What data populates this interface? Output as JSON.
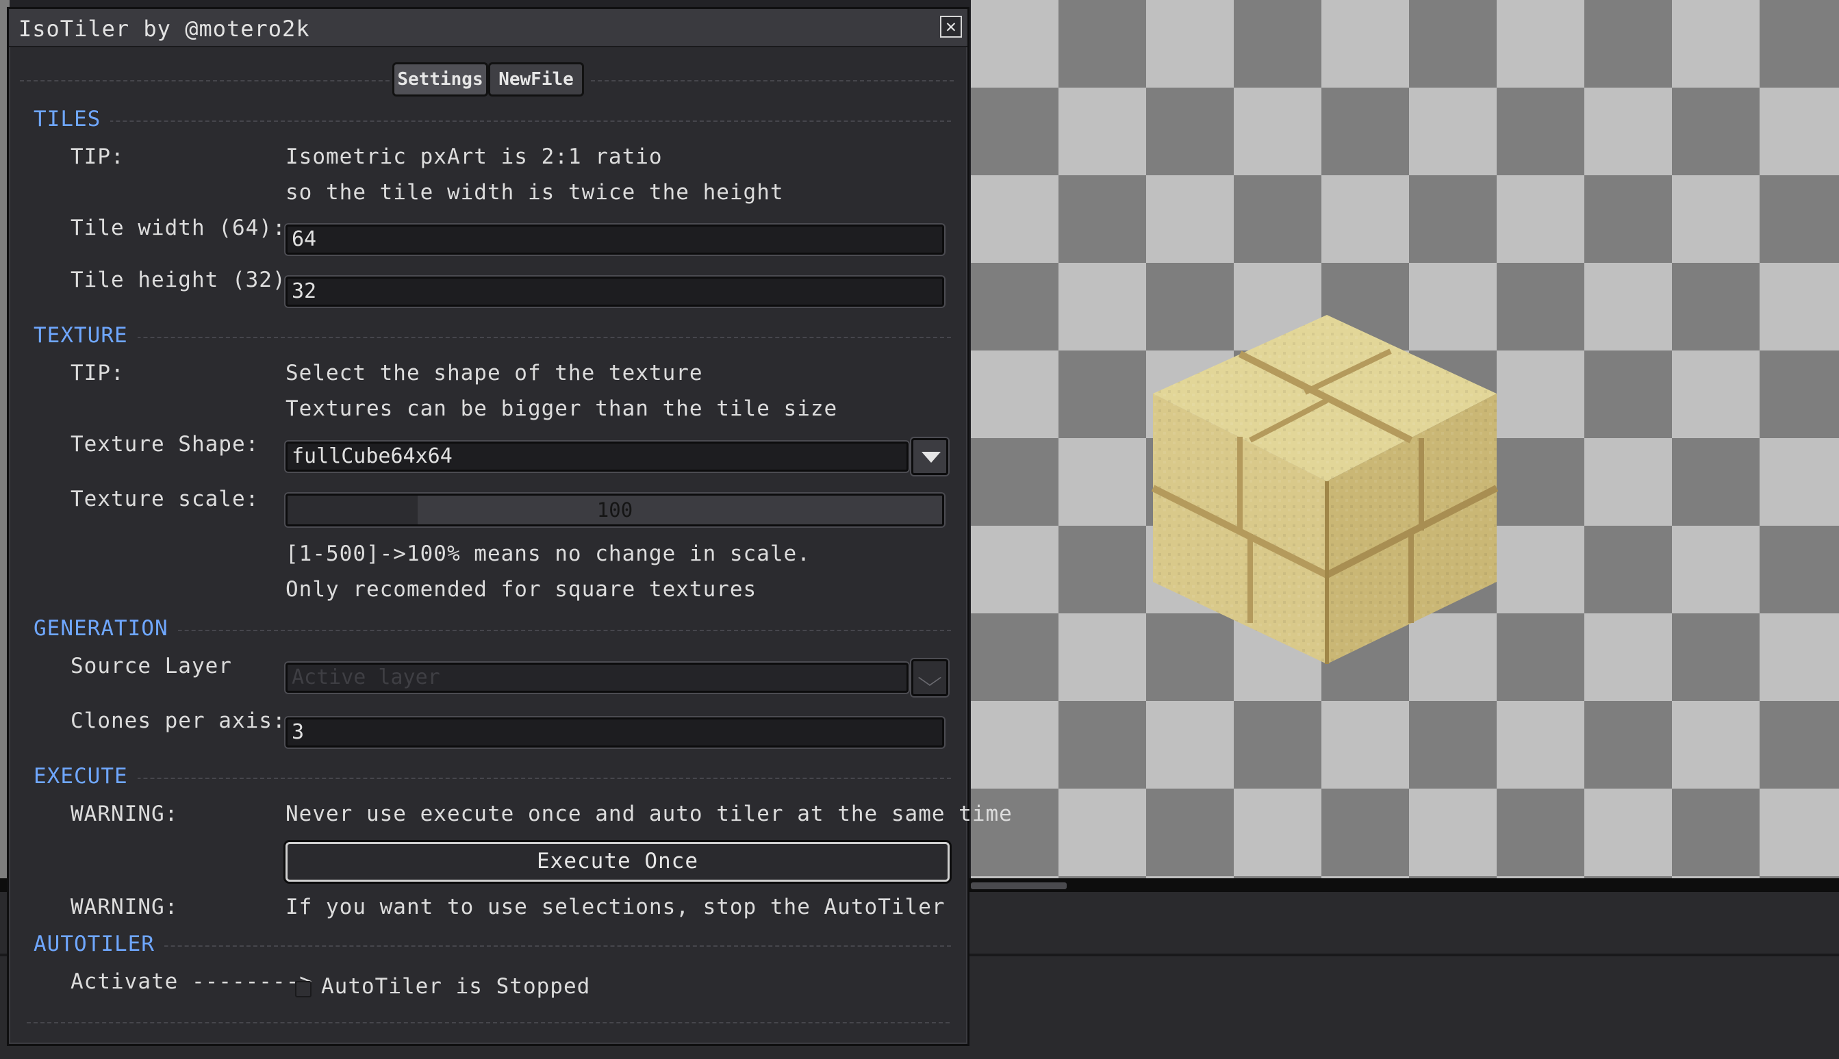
{
  "window": {
    "title": "IsoTiler by @motero2k",
    "close_glyph": "✕"
  },
  "tabs": [
    {
      "label": "Settings",
      "active": true
    },
    {
      "label": "NewFile",
      "active": false
    }
  ],
  "tiles": {
    "header": "TILES",
    "tip_label": "TIP:",
    "tip_line1": "Isometric pxArt is 2:1 ratio",
    "tip_line2": "so the tile width is twice the height",
    "width_label": "Tile width (64):",
    "width_value": "64",
    "height_label": "Tile height (32):",
    "height_value": "32"
  },
  "texture": {
    "header": "TEXTURE",
    "tip_label": "TIP:",
    "tip_line1": "Select the shape of the texture",
    "tip_line2": "Textures can be bigger than the tile size",
    "shape_label": "Texture Shape:",
    "shape_value": "fullCube64x64",
    "scale_label": "Texture scale:",
    "scale_value": "100",
    "scale_min": 1,
    "scale_max": 500,
    "note_line1": "[1-500]->100% means no change in scale.",
    "note_line2": "Only recomended for square textures"
  },
  "generation": {
    "header": "GENERATION",
    "source_label": "Source Layer",
    "source_value": "Active layer",
    "clones_label": "Clones per axis:",
    "clones_value": "3"
  },
  "execute": {
    "header": "EXECUTE",
    "warning1_label": "WARNING:",
    "warning1_text": "Never use execute once and auto tiler at the same time",
    "button_label": "Execute Once",
    "warning2_label": "WARNING:",
    "warning2_text": "If you want to use selections, stop the AutoTiler"
  },
  "autotiler": {
    "header": "AUTOTILER",
    "activate_label": "Activate -------->",
    "checkbox_checked": false,
    "status_text": "AutoTiler is Stopped"
  },
  "colors": {
    "section_header": "#6fa7ff",
    "panel_bg": "#2b2b2f",
    "checker_light": "#c0c0c0",
    "checker_dark": "#7e7e7e"
  },
  "icons": {
    "close": "close-icon",
    "dropdown": "chevron-down-icon"
  }
}
